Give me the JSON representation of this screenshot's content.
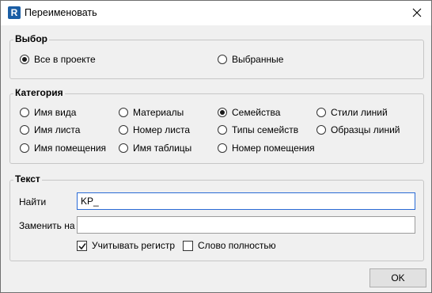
{
  "window": {
    "title": "Переименовать",
    "app_icon_letter": "R",
    "close_icon": "close-icon"
  },
  "selection": {
    "title": "Выбор",
    "options": [
      "Все в проекте",
      "Выбранные"
    ],
    "selected": "Все в проекте"
  },
  "category": {
    "title": "Категория",
    "options": [
      "Имя вида",
      "Материалы",
      "Семейства",
      "Стили линий",
      "Имя листа",
      "Номер листа",
      "Типы семейств",
      "Образцы линий",
      "Имя помещения",
      "Имя таблицы",
      "Номер помещения"
    ],
    "selected": "Семейства"
  },
  "text": {
    "title": "Текст",
    "find_label": "Найти",
    "find_value": "KP_",
    "replace_label": "Заменить на",
    "replace_value": "",
    "match_case_label": "Учитывать регистр",
    "match_case_checked": true,
    "whole_word_label": "Слово полностью",
    "whole_word_checked": false
  },
  "buttons": {
    "ok_label": "OK"
  },
  "colors": {
    "focus_border": "#2a6bd6",
    "app_icon_bg": "#1b5ea5"
  }
}
